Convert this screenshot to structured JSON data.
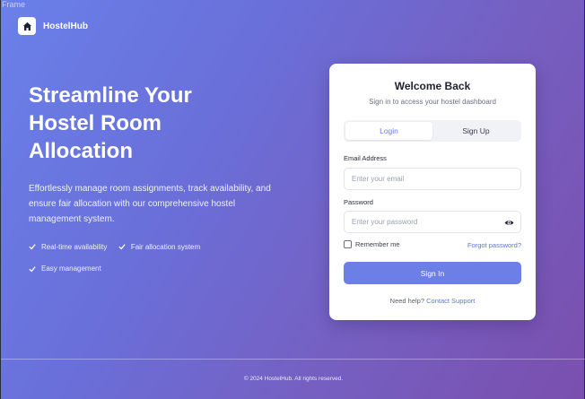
{
  "frame": {
    "label": "Frame"
  },
  "brand": {
    "name": "HostelHub"
  },
  "hero": {
    "title": "Streamline Your Hostel Room Allocation",
    "description": "Effortlessly manage room assignments, track availability, and ensure fair allocation with our comprehensive hostel management system.",
    "features": [
      "Real-time availability",
      "Fair allocation system",
      "Easy management"
    ]
  },
  "login_card": {
    "title": "Welcome Back",
    "subtitle": "Sign in to access your hostel dashboard",
    "tabs": [
      {
        "label": "Login",
        "active": true
      },
      {
        "label": "Sign Up",
        "active": false
      }
    ],
    "email": {
      "label": "Email Address",
      "placeholder": "Enter your email",
      "value": ""
    },
    "password": {
      "label": "Password",
      "placeholder": "Enter your password",
      "value": ""
    },
    "remember_label": "Remember me",
    "remember_checked": false,
    "forgot_label": "Forgot password?",
    "submit_label": "Sign In",
    "help_text": "Need help?",
    "help_link": "Contact Support"
  },
  "footer": {
    "text": "© 2024 HostelHub. All rights reserved."
  },
  "colors": {
    "accent": "#6b7fe6",
    "link": "#5b74e0",
    "gradient_start": "#6a80e9",
    "gradient_end": "#7a4fae"
  },
  "icons": {
    "brand": "home-icon",
    "feature": "check-icon",
    "password_toggle": "eye-icon"
  }
}
